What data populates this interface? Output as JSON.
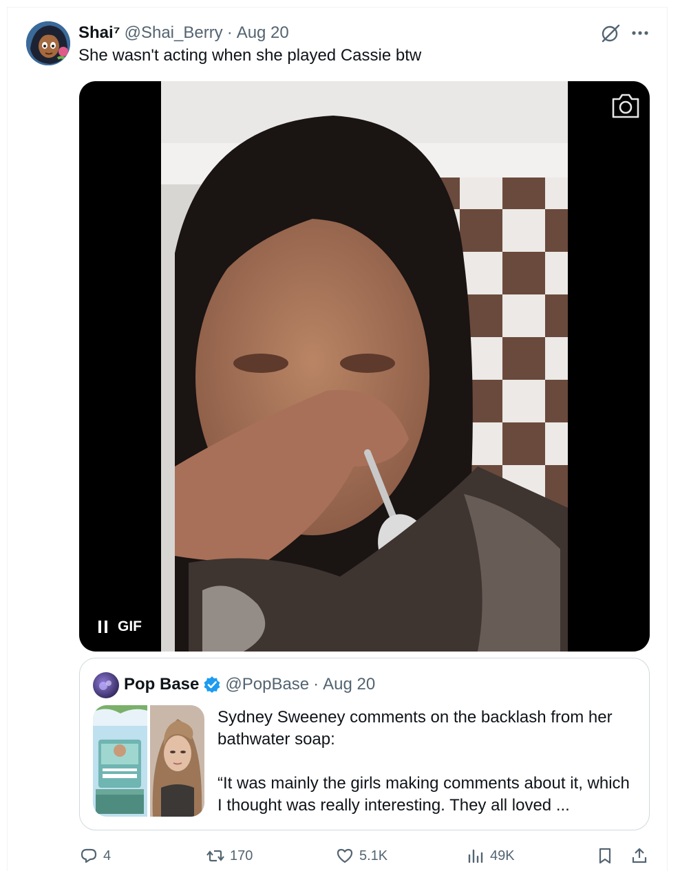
{
  "tweet": {
    "display_name": "Shai⁷",
    "handle": "@Shai_Berry",
    "separator": "·",
    "date": "Aug 20",
    "text": "She wasn't acting when she played Cassie btw",
    "avatar_icon": "cartoon-avatar",
    "media": {
      "type": "gif",
      "badge": "GIF",
      "state": "playing",
      "camera_icon": "camera-icon",
      "pause_icon": "pause-icon"
    }
  },
  "quote": {
    "display_name": "Pop Base",
    "verified": true,
    "verified_color": "#1d9bf0",
    "handle": "@PopBase",
    "separator": "·",
    "date": "Aug 20",
    "text_line1": "Sydney Sweeney comments on the backlash from her bathwater soap:",
    "text_line2": "“It was mainly the girls making comments about it, which I thought was really interesting. They all loved ..."
  },
  "actions": {
    "replies": "4",
    "retweets": "170",
    "likes": "5.1K",
    "views": "49K"
  },
  "colors": {
    "text_primary": "#0f1419",
    "text_secondary": "#536471",
    "border": "#cfd9de",
    "accent": "#1d9bf0"
  }
}
